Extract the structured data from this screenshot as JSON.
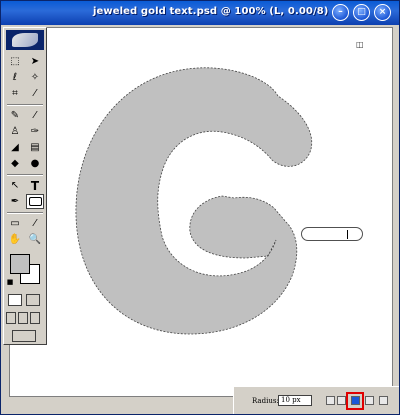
{
  "window": {
    "title": "jeweled gold text.psd @ 100% (L, 0.00/8)",
    "buttons": {
      "minimize": "–",
      "maximize": "□",
      "close": "×"
    }
  },
  "canvas": {
    "corner_marker": "◫",
    "letter": "G",
    "letter_color": "#c0c0c0"
  },
  "toolbox": {
    "tools": [
      "marquee-icon",
      "move-icon",
      "lasso-icon",
      "magic-wand-icon",
      "crop-icon",
      "slice-icon",
      "healing-icon",
      "brush-icon",
      "stamp-icon",
      "history-brush-icon",
      "eraser-icon",
      "gradient-icon",
      "blur-icon",
      "dodge-icon",
      "path-select-icon",
      "type-icon",
      "pen-icon",
      "shape-icon",
      "notes-icon",
      "eyedropper-icon",
      "hand-icon",
      "zoom-icon"
    ],
    "type_glyph": "T",
    "foreground_color": "#c0c0c0",
    "background_color": "#ffffff"
  },
  "options_bar": {
    "radius_label": "Radius:",
    "radius_value": "10 px"
  }
}
